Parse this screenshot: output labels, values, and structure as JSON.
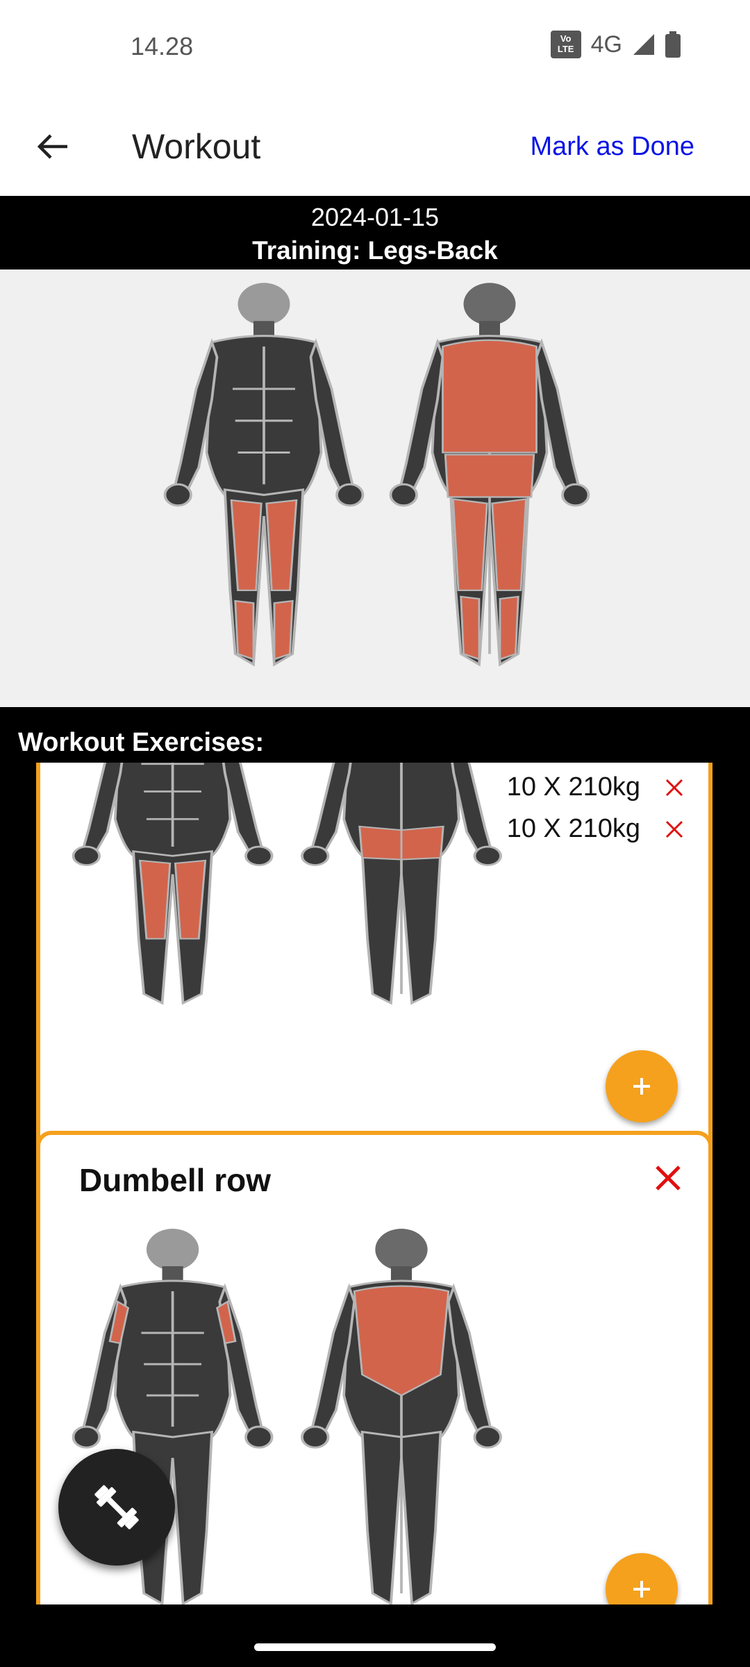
{
  "status_bar": {
    "time": "14.28",
    "volte": "Vo\nLTE",
    "network": "4G"
  },
  "app_bar": {
    "title": "Workout",
    "action_label": "Mark as Done",
    "back_icon": "arrow-left-icon"
  },
  "header": {
    "date": "2024-01-15",
    "training": "Training: Legs-Back"
  },
  "overview": {
    "highlighted_muscles": [
      "quadriceps",
      "calves",
      "back",
      "glutes",
      "hamstrings"
    ]
  },
  "section_title": "Workout Exercises:",
  "exercises": [
    {
      "sets": [
        {
          "label": "10 X 210kg"
        },
        {
          "label": "10 X 210kg"
        }
      ],
      "highlighted_muscles": [
        "quadriceps",
        "glutes"
      ]
    },
    {
      "name": "Dumbell row",
      "highlighted_muscles": [
        "biceps",
        "lats"
      ]
    }
  ],
  "colors": {
    "accent": "#f5a11d",
    "muscle_highlight": "#d2644c",
    "muscle_base": "#3a3a3a",
    "link_blue": "#0a14e6",
    "remove_red": "#e01010"
  },
  "fab": {
    "icon": "dumbbell-icon"
  }
}
